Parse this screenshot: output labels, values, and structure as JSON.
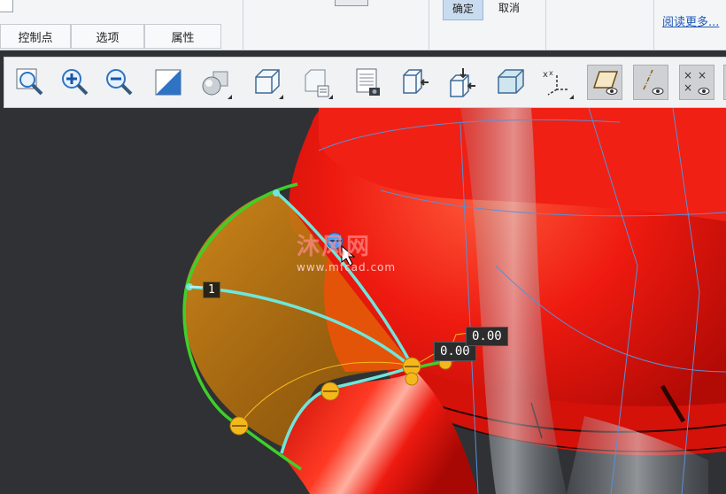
{
  "ribbon": {
    "tabs": [
      {
        "label": "控制点"
      },
      {
        "label": "选项"
      },
      {
        "label": "属性"
      }
    ],
    "ok_label": "确定",
    "cancel_label": "取消",
    "more_label": "阅读更多..."
  },
  "toolbar": {
    "tools": [
      {
        "name": "zoom-fit-icon"
      },
      {
        "name": "zoom-in-icon"
      },
      {
        "name": "zoom-out-icon"
      },
      {
        "name": "repaint-icon"
      },
      {
        "name": "display-style-icon"
      },
      {
        "name": "standard-orientation-icon"
      },
      {
        "name": "saved-views-icon"
      },
      {
        "name": "view-manager-icon"
      },
      {
        "name": "spin-center-icon"
      },
      {
        "name": "normal-view-icon"
      },
      {
        "name": "perspective-icon"
      },
      {
        "name": "annotation-display-icon"
      },
      {
        "name": "plane-display-icon"
      },
      {
        "name": "axis-display-icon"
      },
      {
        "name": "point-display-icon"
      }
    ]
  },
  "viewport": {
    "labels": {
      "dim1": "1",
      "dim2": "0.00",
      "dim3": "0.00"
    },
    "watermark": {
      "title": "沐风网",
      "url": "www.mfcad.com"
    }
  },
  "colors": {
    "model_red": "#e8160c",
    "surface_orange": "#c47a12",
    "boundary_green": "#3fcf2a",
    "curve_cyan": "#6fe6dc",
    "handle_yellow": "#f5b81c",
    "background": "#2f3134"
  }
}
